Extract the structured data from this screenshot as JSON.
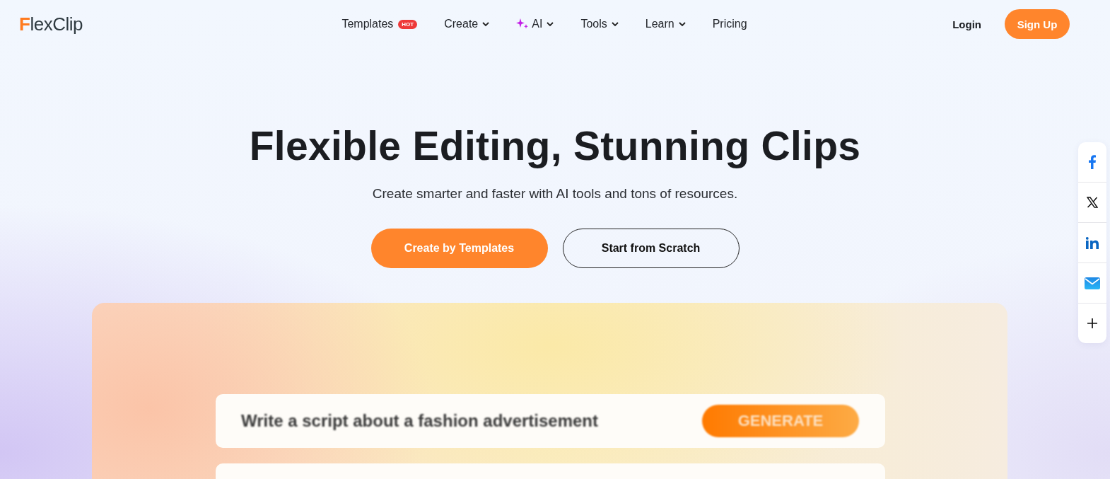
{
  "logo": {
    "text": "FlexClip"
  },
  "nav": [
    {
      "label": "Templates",
      "badge": "HOT",
      "sparkle": false,
      "dropdown": false
    },
    {
      "label": "Create",
      "sparkle": false,
      "dropdown": true
    },
    {
      "label": "AI",
      "sparkle": true,
      "dropdown": true
    },
    {
      "label": "Tools",
      "sparkle": false,
      "dropdown": true
    },
    {
      "label": "Learn",
      "sparkle": false,
      "dropdown": true
    },
    {
      "label": "Pricing",
      "sparkle": false,
      "dropdown": false
    }
  ],
  "auth": {
    "login": "Login",
    "signup": "Sign Up"
  },
  "hero": {
    "title": "Flexible Editing, Stunning Clips",
    "subtitle": "Create smarter and faster with AI tools and tons of resources.",
    "buttons": [
      {
        "label": "Create by Templates",
        "kind": "primary"
      },
      {
        "label": "Start from Scratch",
        "kind": "outline"
      }
    ]
  },
  "preview": {
    "prompt": "Write a script about a fashion advertisement",
    "action": "GENERATE"
  },
  "share": [
    {
      "kind": "facebook"
    },
    {
      "kind": "x"
    },
    {
      "kind": "linkedin"
    },
    {
      "kind": "email"
    },
    {
      "kind": "more"
    }
  ]
}
